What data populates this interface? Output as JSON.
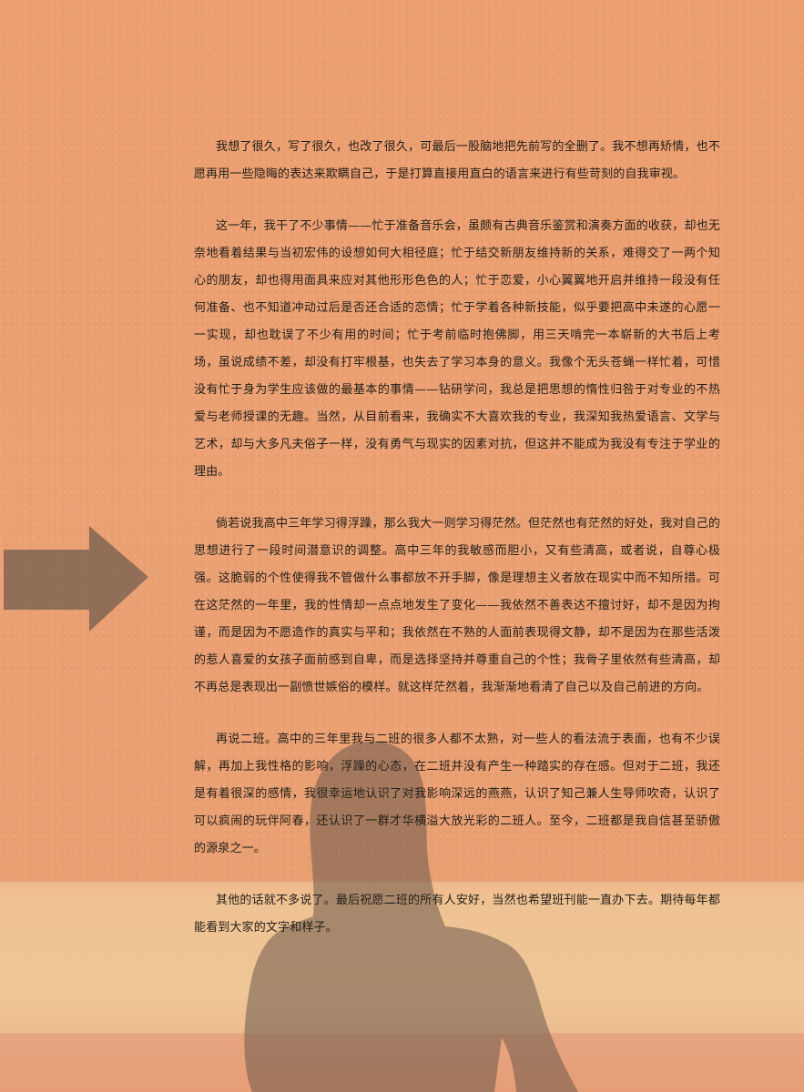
{
  "page": {
    "background_color": "#eb9e70",
    "ledge_color": "#efc697",
    "shadow_color": "#6f5b4d"
  },
  "decor": {
    "left_shape": "arrow-right-shadow-icon",
    "bottom_shape": "person-silhouette-shadow"
  },
  "article": {
    "paragraphs": [
      "我想了很久，写了很久，也改了很久，可最后一股脑地把先前写的全删了。我不想再矫情，也不愿再用一些隐晦的表达来欺瞒自己，于是打算直接用直白的语言来进行有些苛刻的自我审视。",
      "这一年，我干了不少事情——忙于准备音乐会，虽颇有古典音乐鉴赏和演奏方面的收获，却也无奈地看着结果与当初宏伟的设想如何大相径庭；忙于结交新朋友维持新的关系，难得交了一两个知心的朋友，却也得用面具来应对其他形形色色的人；忙于恋爱，小心翼翼地开启并维持一段没有任何准备、也不知道冲动过后是否还合适的恋情；忙于学着各种新技能，似乎要把高中未遂的心愿一一实现，却也耽误了不少有用的时间；忙于考前临时抱佛脚，用三天啃完一本崭新的大书后上考场，虽说成绩不差，却没有打牢根基，也失去了学习本身的意义。我像个无头苍蝇一样忙着，可惜没有忙于身为学生应该做的最基本的事情——钻研学问，我总是把思想的惰性归咎于对专业的不热爱与老师授课的无趣。当然，从目前看来，我确实不大喜欢我的专业，我深知我热爱语言、文学与艺术，却与大多凡夫俗子一样，没有勇气与现实的因素对抗，但这并不能成为我没有专注于学业的理由。",
      "倘若说我高中三年学习得浮躁，那么我大一则学习得茫然。但茫然也有茫然的好处，我对自己的思想进行了一段时间潜意识的调整。高中三年的我敏感而胆小，又有些清高，或者说，自尊心极强。这脆弱的个性使得我不管做什么事都放不开手脚，像是理想主义者放在现实中而不知所措。可在这茫然的一年里，我的性情却一点点地发生了变化——我依然不善表达不擅讨好，却不是因为拘谨，而是因为不愿造作的真实与平和；我依然在不熟的人面前表现得文静，却不是因为在那些活泼的惹人喜爱的女孩子面前感到自卑，而是选择坚持并尊重自己的个性；我骨子里依然有些清高，却不再总是表现出一副愤世嫉俗的模样。就这样茫然着，我渐渐地看清了自己以及自己前进的方向。",
      "再说二班。高中的三年里我与二班的很多人都不太熟，对一些人的看法流于表面，也有不少误解，再加上我性格的影响，浮躁的心态，在二班并没有产生一种踏实的存在感。但对于二班，我还是有着很深的感情，我很幸运地认识了对我影响深远的燕燕，认识了知己兼人生导师吹奇，认识了可以疯闹的玩伴阿春，还认识了一群才华横溢大放光彩的二班人。至今，二班都是我自信甚至骄傲的源泉之一。",
      "其他的话就不多说了。最后祝愿二班的所有人安好，当然也希望班刊能一直办下去。期待每年都能看到大家的文字和样子。"
    ]
  }
}
